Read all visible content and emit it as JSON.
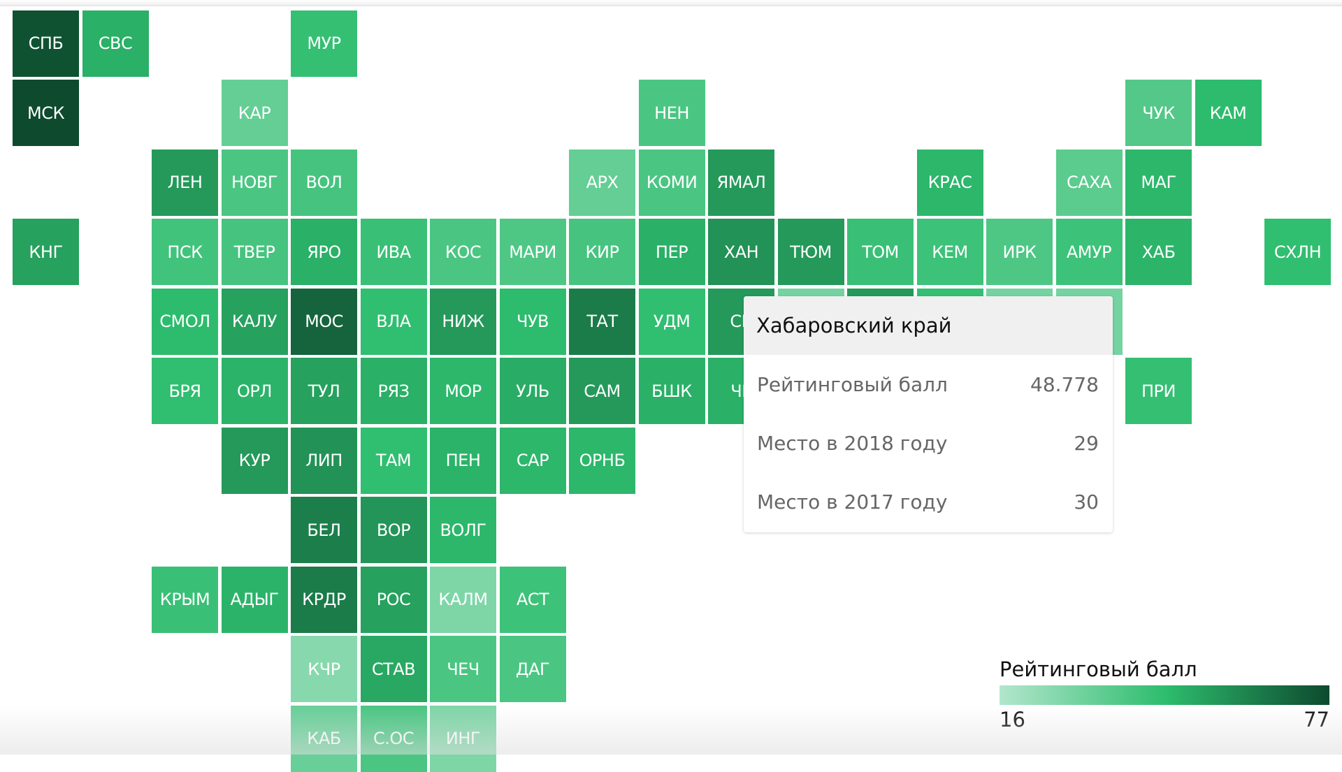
{
  "chart_data": {
    "type": "heatmap",
    "subtype": "tile-grid-map",
    "title": "Рейтинговый балл",
    "value_range": [
      16,
      77
    ],
    "color_scale": [
      "#b2e6cc",
      "#2ebd6e",
      "#0d4a2e"
    ],
    "regions": [
      {
        "abbr": "СПБ",
        "row": 0,
        "col": 0,
        "score": 75
      },
      {
        "abbr": "СВС",
        "row": 0,
        "col": 1,
        "score": 50
      },
      {
        "abbr": "МУР",
        "row": 0,
        "col": 4,
        "score": 45
      },
      {
        "abbr": "МСК",
        "row": 1,
        "col": 0,
        "score": 77
      },
      {
        "abbr": "КАР",
        "row": 1,
        "col": 3,
        "score": 34
      },
      {
        "abbr": "НЕН",
        "row": 1,
        "col": 9,
        "score": 40
      },
      {
        "abbr": "ЧУК",
        "row": 1,
        "col": 16,
        "score": 38
      },
      {
        "abbr": "КАМ",
        "row": 1,
        "col": 17,
        "score": 47
      },
      {
        "abbr": "ЛЕН",
        "row": 2,
        "col": 2,
        "score": 56
      },
      {
        "abbr": "НОВГ",
        "row": 2,
        "col": 3,
        "score": 40
      },
      {
        "abbr": "ВОЛ",
        "row": 2,
        "col": 4,
        "score": 41
      },
      {
        "abbr": "АРХ",
        "row": 2,
        "col": 8,
        "score": 34
      },
      {
        "abbr": "КОМИ",
        "row": 2,
        "col": 9,
        "score": 40
      },
      {
        "abbr": "ЯМАЛ",
        "row": 2,
        "col": 10,
        "score": 56
      },
      {
        "abbr": "КРАС",
        "row": 2,
        "col": 13,
        "score": 48
      },
      {
        "abbr": "САХА",
        "row": 2,
        "col": 15,
        "score": 36
      },
      {
        "abbr": "МАГ",
        "row": 2,
        "col": 16,
        "score": 48
      },
      {
        "abbr": "КНГ",
        "row": 3,
        "col": 0,
        "score": 54
      },
      {
        "abbr": "ПСК",
        "row": 3,
        "col": 2,
        "score": 42
      },
      {
        "abbr": "ТВЕР",
        "row": 3,
        "col": 3,
        "score": 41
      },
      {
        "abbr": "ЯРО",
        "row": 3,
        "col": 4,
        "score": 50
      },
      {
        "abbr": "ИВА",
        "row": 3,
        "col": 5,
        "score": 44
      },
      {
        "abbr": "КОС",
        "row": 3,
        "col": 6,
        "score": 40
      },
      {
        "abbr": "МАРИ",
        "row": 3,
        "col": 7,
        "score": 39
      },
      {
        "abbr": "КИР",
        "row": 3,
        "col": 8,
        "score": 41
      },
      {
        "abbr": "ПЕР",
        "row": 3,
        "col": 9,
        "score": 50
      },
      {
        "abbr": "ХАН",
        "row": 3,
        "col": 10,
        "score": 58
      },
      {
        "abbr": "ТЮМ",
        "row": 3,
        "col": 11,
        "score": 56
      },
      {
        "abbr": "ТОМ",
        "row": 3,
        "col": 12,
        "score": 44
      },
      {
        "abbr": "КЕМ",
        "row": 3,
        "col": 13,
        "score": 43
      },
      {
        "abbr": "ИРК",
        "row": 3,
        "col": 14,
        "score": 39
      },
      {
        "abbr": "АМУР",
        "row": 3,
        "col": 15,
        "score": 43
      },
      {
        "abbr": "ХАБ",
        "row": 3,
        "col": 16,
        "score": 48.778
      },
      {
        "abbr": "СХЛН",
        "row": 3,
        "col": 18,
        "score": 46
      },
      {
        "abbr": "СМОЛ",
        "row": 4,
        "col": 2,
        "score": 47
      },
      {
        "abbr": "КАЛУ",
        "row": 4,
        "col": 3,
        "score": 54
      },
      {
        "abbr": "МОС",
        "row": 4,
        "col": 4,
        "score": 70
      },
      {
        "abbr": "ВЛА",
        "row": 4,
        "col": 5,
        "score": 46
      },
      {
        "abbr": "НИЖ",
        "row": 4,
        "col": 6,
        "score": 56
      },
      {
        "abbr": "ЧУВ",
        "row": 4,
        "col": 7,
        "score": 47
      },
      {
        "abbr": "ТАТ",
        "row": 4,
        "col": 8,
        "score": 64
      },
      {
        "abbr": "УДМ",
        "row": 4,
        "col": 9,
        "score": 46
      },
      {
        "abbr": "СВ",
        "row": 4,
        "col": 10,
        "score": 56
      },
      {
        "abbr": "",
        "row": 4,
        "col": 11,
        "score": 30
      },
      {
        "abbr": "",
        "row": 4,
        "col": 12,
        "score": 56
      },
      {
        "abbr": "",
        "row": 4,
        "col": 13,
        "score": 45
      },
      {
        "abbr": "",
        "row": 4,
        "col": 14,
        "score": 30
      },
      {
        "abbr": "",
        "row": 4,
        "col": 15,
        "score": 30
      },
      {
        "abbr": "БРЯ",
        "row": 5,
        "col": 2,
        "score": 46
      },
      {
        "abbr": "ОРЛ",
        "row": 5,
        "col": 3,
        "score": 49
      },
      {
        "abbr": "ТУЛ",
        "row": 5,
        "col": 4,
        "score": 54
      },
      {
        "abbr": "РЯЗ",
        "row": 5,
        "col": 5,
        "score": 50
      },
      {
        "abbr": "МОР",
        "row": 5,
        "col": 6,
        "score": 48
      },
      {
        "abbr": "УЛЬ",
        "row": 5,
        "col": 7,
        "score": 51
      },
      {
        "abbr": "САМ",
        "row": 5,
        "col": 8,
        "score": 56
      },
      {
        "abbr": "БШК",
        "row": 5,
        "col": 9,
        "score": 50
      },
      {
        "abbr": "ЧЕ",
        "row": 5,
        "col": 10,
        "score": 50
      },
      {
        "abbr": "ПРИ",
        "row": 5,
        "col": 16,
        "score": 45
      },
      {
        "abbr": "КУР",
        "row": 6,
        "col": 3,
        "score": 56
      },
      {
        "abbr": "ЛИП",
        "row": 6,
        "col": 4,
        "score": 58
      },
      {
        "abbr": "ТАМ",
        "row": 6,
        "col": 5,
        "score": 46
      },
      {
        "abbr": "ПЕН",
        "row": 6,
        "col": 6,
        "score": 49
      },
      {
        "abbr": "САР",
        "row": 6,
        "col": 7,
        "score": 48
      },
      {
        "abbr": "ОРНБ",
        "row": 6,
        "col": 8,
        "score": 48
      },
      {
        "abbr": "БЕЛ",
        "row": 7,
        "col": 4,
        "score": 63
      },
      {
        "abbr": "ВОР",
        "row": 7,
        "col": 5,
        "score": 57
      },
      {
        "abbr": "ВОЛГ",
        "row": 7,
        "col": 6,
        "score": 48
      },
      {
        "abbr": "КРЫМ",
        "row": 8,
        "col": 2,
        "score": 44
      },
      {
        "abbr": "АДЫГ",
        "row": 8,
        "col": 3,
        "score": 49
      },
      {
        "abbr": "КРДР",
        "row": 8,
        "col": 4,
        "score": 64
      },
      {
        "abbr": "РОС",
        "row": 8,
        "col": 5,
        "score": 54
      },
      {
        "abbr": "КАЛМ",
        "row": 8,
        "col": 6,
        "score": 28
      },
      {
        "abbr": "АСТ",
        "row": 8,
        "col": 7,
        "score": 43
      },
      {
        "abbr": "КЧР",
        "row": 9,
        "col": 4,
        "score": 26
      },
      {
        "abbr": "СТАВ",
        "row": 9,
        "col": 5,
        "score": 52
      },
      {
        "abbr": "ЧЕЧ",
        "row": 9,
        "col": 6,
        "score": 40
      },
      {
        "abbr": "ДАГ",
        "row": 9,
        "col": 7,
        "score": 40
      },
      {
        "abbr": "КАБ",
        "row": 10,
        "col": 4,
        "score": 33
      },
      {
        "abbr": "С.ОС",
        "row": 10,
        "col": 5,
        "score": 40
      },
      {
        "abbr": "ИНГ",
        "row": 10,
        "col": 6,
        "score": 28
      }
    ]
  },
  "tooltip": {
    "title": "Хабаровский край",
    "rows": [
      {
        "label": "Рейтинговый балл",
        "value": "48.778"
      },
      {
        "label": "Место в 2018 году",
        "value": "29"
      },
      {
        "label": "Место в 2017 году",
        "value": "30"
      }
    ]
  },
  "legend": {
    "title": "Рейтинговый балл",
    "min_label": "16",
    "max_label": "77"
  }
}
